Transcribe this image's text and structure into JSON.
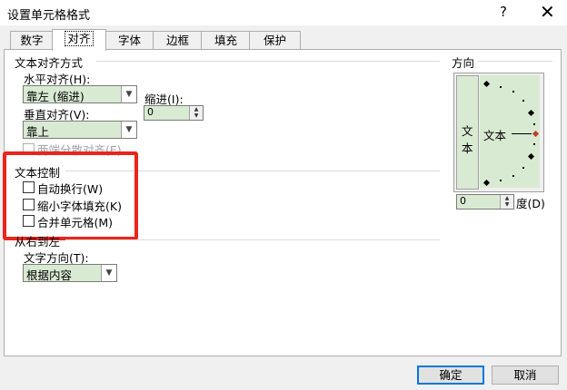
{
  "window": {
    "title": "设置单元格格式",
    "help_icon": "?",
    "close_icon": "✕"
  },
  "tabs": [
    {
      "label": "数字",
      "active": false
    },
    {
      "label": "对齐",
      "active": true
    },
    {
      "label": "字体",
      "active": false
    },
    {
      "label": "边框",
      "active": false
    },
    {
      "label": "填充",
      "active": false
    },
    {
      "label": "保护",
      "active": false
    }
  ],
  "alignment": {
    "group_title": "文本对齐方式",
    "horizontal_label": "水平对齐(H):",
    "horizontal_value": "靠左 (缩进)",
    "indent_label": "缩进(I):",
    "indent_value": "0",
    "vertical_label": "垂直对齐(V):",
    "vertical_value": "靠上",
    "justify_distributed_label": "两端分散对齐(E)"
  },
  "text_control": {
    "group_title": "文本控制",
    "wrap_text": {
      "label": "自动换行(W)",
      "checked": false
    },
    "shrink_to_fit": {
      "label": "缩小字体填充(K)",
      "checked": false
    },
    "merge_cells": {
      "label": "合并单元格(M)",
      "checked": false
    }
  },
  "rtl": {
    "group_title": "从右到左",
    "direction_label": "文字方向(T):",
    "direction_value": "根据内容"
  },
  "orientation": {
    "group_title": "方向",
    "vertical_text": "文本",
    "dial_text": "文本",
    "degree_value": "0",
    "degree_label": "度(D)"
  },
  "buttons": {
    "ok": "确定",
    "cancel": "取消"
  },
  "colors": {
    "highlight_box": "#e8261c",
    "field_fill": "#d9ead3",
    "default_button_border": "#0078d7"
  }
}
